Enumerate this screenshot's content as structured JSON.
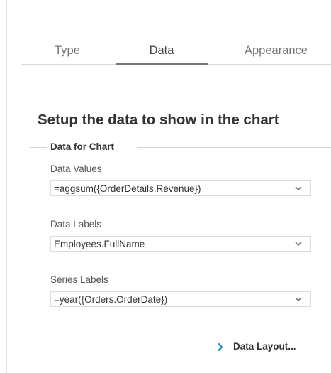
{
  "tabs": [
    {
      "label": "Type",
      "active": false
    },
    {
      "label": "Data",
      "active": true
    },
    {
      "label": "Appearance",
      "active": false
    }
  ],
  "heading": "Setup the data to show in the chart",
  "section": {
    "legend": "Data for Chart",
    "fields": [
      {
        "label": "Data Values",
        "value": "=aggsum({OrderDetails.Revenue})",
        "icon": "chevron-down-icon"
      },
      {
        "label": "Data Labels",
        "value": "Employees.FullName",
        "icon": "chevron-down-icon"
      },
      {
        "label": "Series Labels",
        "value": "=year({Orders.OrderDate})",
        "icon": "chevron-down-icon"
      }
    ]
  },
  "data_layout": {
    "label": "Data Layout...",
    "icon": "chevron-right-icon",
    "icon_color": "#2e8fd0"
  }
}
